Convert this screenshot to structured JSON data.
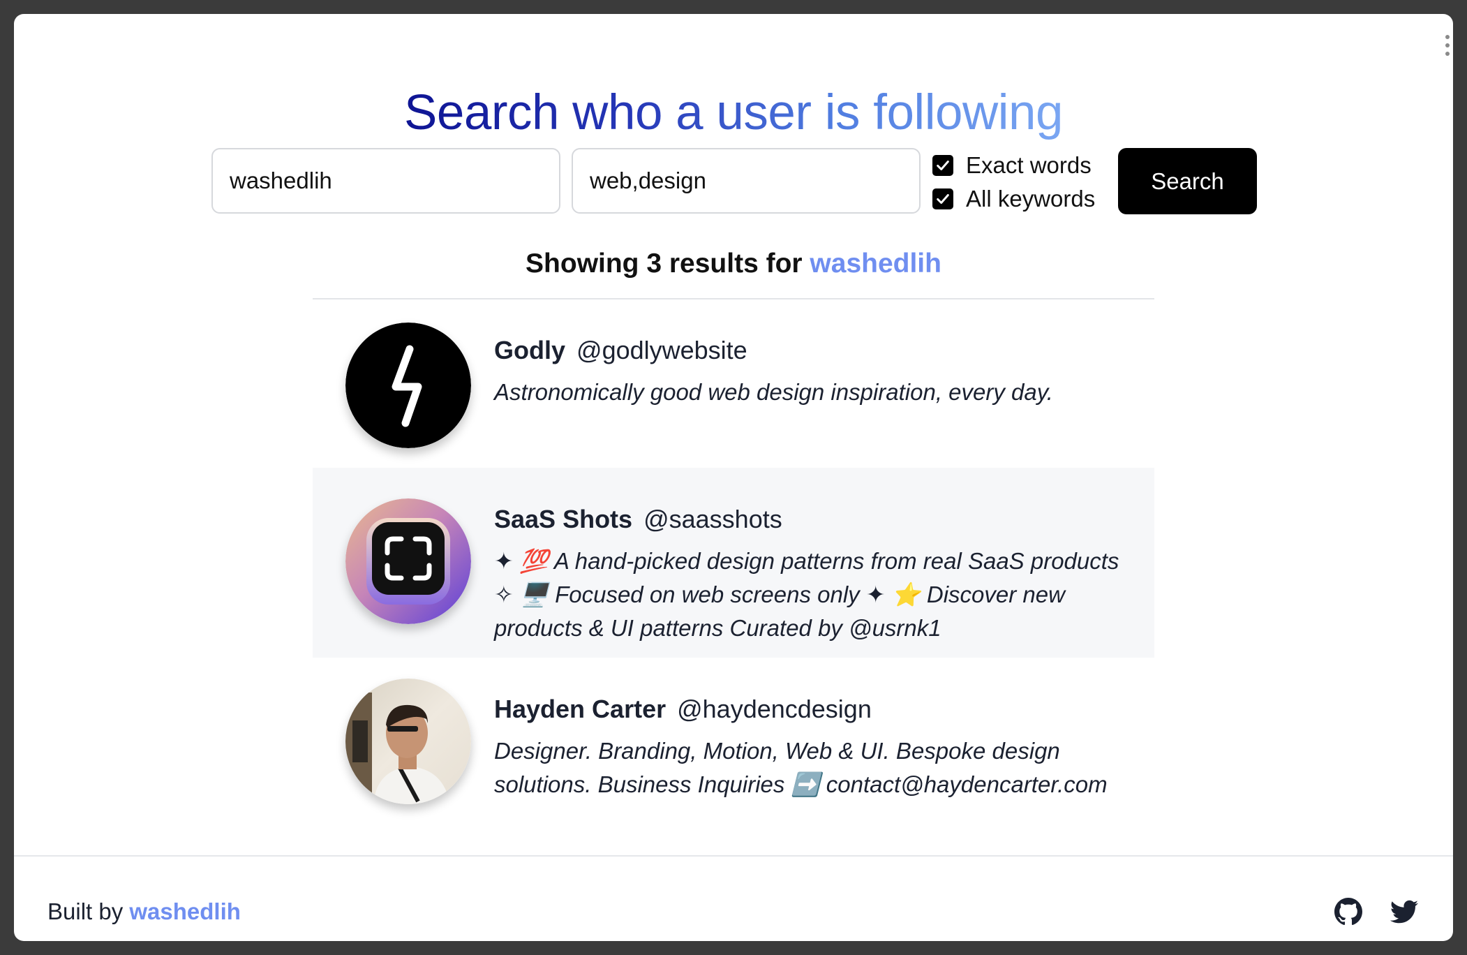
{
  "header": {
    "title": "Search who a user is following"
  },
  "search": {
    "username_value": "washedlih",
    "keywords_value": "web,design",
    "exact_words_label": "Exact words",
    "exact_words_checked": true,
    "all_keywords_label": "All keywords",
    "all_keywords_checked": true,
    "button_label": "Search"
  },
  "results": {
    "prefix": "Showing 3 results for ",
    "username": "washedlih",
    "users": [
      {
        "name": "Godly",
        "handle": "@godlywebsite",
        "bio": "Astronomically good web design inspiration, every day.",
        "avatar": "lightning-bolt-avatar"
      },
      {
        "name": "SaaS Shots",
        "handle": "@saasshots",
        "bio": "✦ 💯 A hand-picked design patterns from real SaaS products ✧ 🖥️ Focused on web screens only ✦ ⭐ Discover new products & UI patterns Curated by @usrnk1",
        "avatar": "screenshot-frame-avatar"
      },
      {
        "name": "Hayden Carter",
        "handle": "@haydencdesign",
        "bio": "Designer. Branding, Motion, Web & UI. Bespoke design solutions. Business Inquiries ➡️ contact@haydencarter.com",
        "avatar": "person-photo-avatar"
      }
    ]
  },
  "footer": {
    "built_by_prefix": "Built by ",
    "author": "washedlih",
    "icons": [
      "github-icon",
      "twitter-icon"
    ]
  },
  "colors": {
    "accent": "#6f8ef0",
    "button": "#000000",
    "title_gradient": [
      "#0e1493",
      "#2638b8",
      "#4f7ce0",
      "#7aa6f2"
    ],
    "alt_row": "#f6f7f9"
  }
}
